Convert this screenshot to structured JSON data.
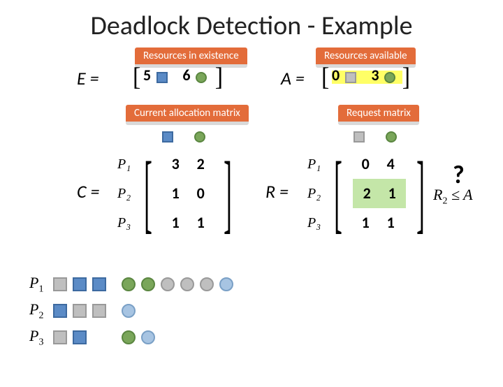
{
  "title": "Deadlock Detection - Example",
  "labels": {
    "E": "E =",
    "C": "C =",
    "A": "A =",
    "R": "R =",
    "P1a": "P",
    "P1b": "1",
    "P2a": "P",
    "P2b": "2",
    "P3a": "P",
    "P3b": "3"
  },
  "tags": {
    "existence": "Resources in existence",
    "available": "Resources available",
    "alloc": "Current allocation matrix",
    "request": "Request matrix"
  },
  "E": {
    "v1": "5",
    "v2": "6",
    "lb": "[",
    "rb": "]"
  },
  "A": {
    "v1": "0",
    "v2": "3",
    "lb": "[",
    "rb": "]"
  },
  "C": {
    "r1c1": "3",
    "r1c2": "2",
    "r2c1": "1",
    "r2c2": "0",
    "r3c1": "1",
    "r3c2": "1",
    "P1": "P₁",
    "P2": "P₂",
    "P3": "P₃",
    "lb": "[",
    "rb": "]"
  },
  "R": {
    "r1c1": "0",
    "r1c2": "4",
    "r2c1": "2",
    "r2c2": "1",
    "r3c1": "1",
    "r3c2": "1",
    "P1": "P₁",
    "P2": "P₂",
    "P3": "P₃",
    "lb": "[",
    "rb": "]"
  },
  "question": {
    "mark": "?",
    "expr_lhs": "R",
    "expr_sub": "2",
    "expr_rhs": " ≤ A"
  }
}
